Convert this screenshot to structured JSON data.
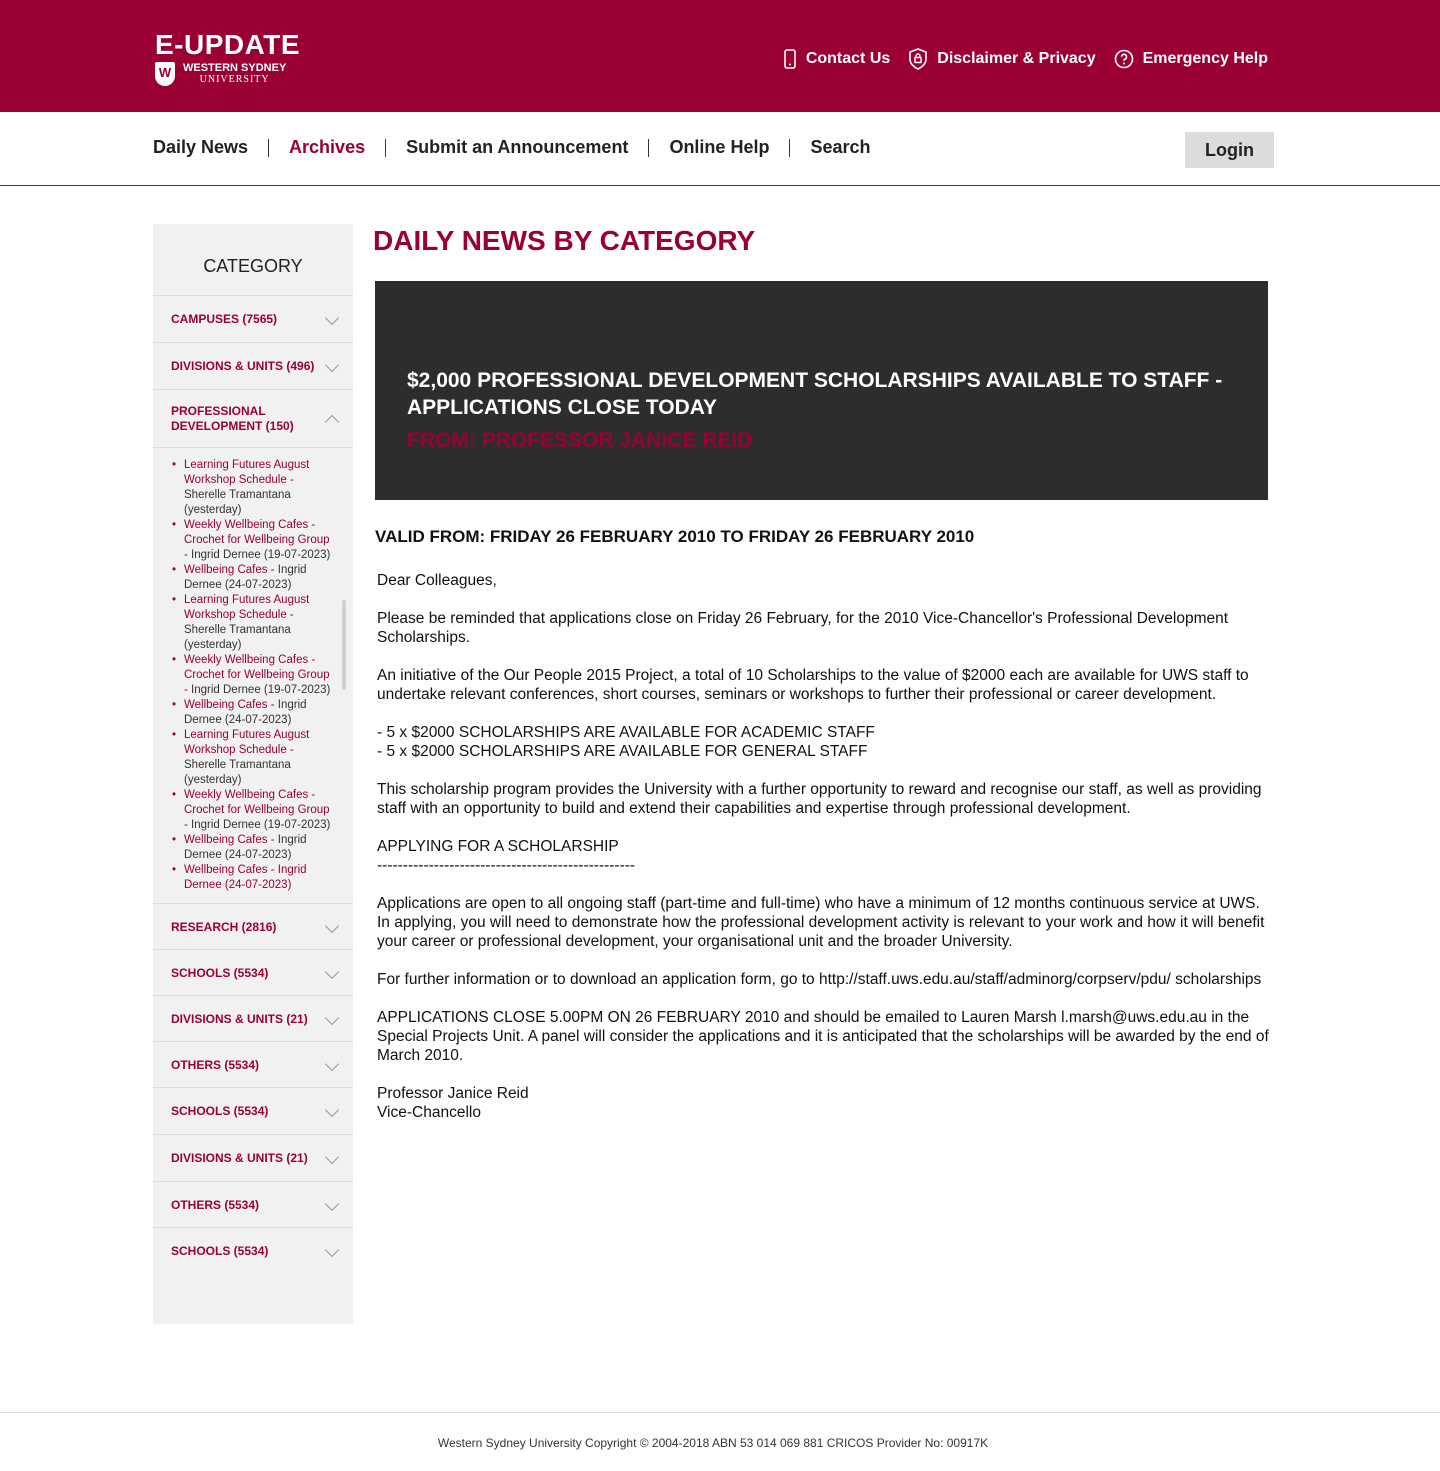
{
  "header": {
    "logo_title": "E-UPDATE",
    "logo_shield": "W",
    "logo_university_line1": "WESTERN SYDNEY",
    "logo_university_line2": "UNIVERSITY",
    "links": [
      {
        "label": "Contact Us",
        "icon": "phone-icon"
      },
      {
        "label": "Disclaimer & Privacy",
        "icon": "shield-lock-icon"
      },
      {
        "label": "Emergency Help",
        "icon": "help-circle-icon"
      }
    ]
  },
  "nav": {
    "items": [
      "Daily News",
      "Archives",
      "Submit an Announcement",
      "Online Help",
      "Search"
    ],
    "active": "Archives",
    "login_label": "Login"
  },
  "sidebar": {
    "heading": "CATEGORY",
    "top_items": [
      {
        "label": "CAMPUSES (7565)"
      },
      {
        "label": "DIVISIONS & UNITS (496)"
      },
      {
        "label": "PROFESSIONAL DEVELOPMENT (150)",
        "expanded": true
      }
    ],
    "sub_items": [
      {
        "link": "Learning Futures August Workshop Schedule - ",
        "meta": "Sherelle Tramantana (yesterday)"
      },
      {
        "link": "Weekly Wellbeing Cafes - Crochet for Wellbeing Group - ",
        "meta": "Ingrid Dernee (19-07-2023)"
      },
      {
        "link": "Wellbeing Cafes - ",
        "meta": "Ingrid Dernee (24-07-2023)"
      },
      {
        "link": "Learning Futures August Workshop Schedule - ",
        "meta": "Sherelle Tramantana (yesterday)"
      },
      {
        "link": "Weekly Wellbeing Cafes - Crochet for Wellbeing Group - ",
        "meta": "Ingrid Dernee (19-07-2023)"
      },
      {
        "link": "Wellbeing Cafes - ",
        "meta": "Ingrid Dernee (24-07-2023)"
      },
      {
        "link": "Learning Futures August Workshop Schedule - ",
        "meta": "Sherelle Tramantana (yesterday)"
      },
      {
        "link": "Weekly Wellbeing Cafes - Crochet for Wellbeing Group - ",
        "meta": "Ingrid Dernee (19-07-2023)"
      },
      {
        "link": "Wellbeing Cafes - ",
        "meta": "Ingrid Dernee (24-07-2023)"
      },
      {
        "link": "Wellbeing Cafes - Ingrid Dernee (24-07-2023)",
        "meta": ""
      }
    ],
    "bottom_items": [
      {
        "label": "RESEARCH (2816)"
      },
      {
        "label": "SCHOOLS (5534)"
      },
      {
        "label": "DIVISIONS & UNITS (21)"
      },
      {
        "label": "OTHERS (5534)"
      },
      {
        "label": "SCHOOLS (5534)"
      },
      {
        "label": "DIVISIONS & UNITS (21)"
      },
      {
        "label": "OTHERS (5534)"
      },
      {
        "label": "SCHOOLS (5534)"
      }
    ]
  },
  "main": {
    "title": "DAILY NEWS BY CATEGORY",
    "hero_title": "$2,000 PROFESSIONAL DEVELOPMENT SCHOLARSHIPS AVAILABLE TO STAFF - APPLICATIONS CLOSE TODAY",
    "hero_from": "FROM: PROFESSOR JANICE REID",
    "valid": "VALID FROM: FRIDAY 26 FEBRUARY 2010 TO FRIDAY 26 FEBRUARY 2010",
    "paragraphs": [
      "Dear Colleagues,",
      "Please be reminded that applications close on Friday 26 February, for the 2010 Vice-Chancellor's Professional Development Scholarships.",
      "An initiative of the Our People 2015 Project, a total of 10 Scholarships to the value of $2000 each are available for UWS staff to undertake relevant conferences, short courses, seminars or workshops to further their professional or career development.",
      "- 5 x $2000 SCHOLARSHIPS ARE AVAILABLE FOR ACADEMIC STAFF\n- 5 x $2000 SCHOLARSHIPS ARE AVAILABLE FOR GENERAL STAFF",
      "This scholarship program provides the University with a further opportunity to reward and recognise our staff, as well as providing staff with an opportunity to build and extend their capabilities and expertise through professional development.",
      "APPLYING FOR A SCHOLARSHIP\n--------------------------------------------------",
      "Applications are open to all ongoing staff (part-time and full-time) who have a minimum of 12 months continuous service at UWS. In applying, you will need to demonstrate how the professional development activity is relevant to your work and how it will benefit your career or professional development, your organisational unit and the broader University.",
      "For further information or to download an application form, go to http://staff.uws.edu.au/staff/adminorg/corpserv/pdu/ scholarships",
      "APPLICATIONS CLOSE 5.00PM ON 26 FEBRUARY 2010 and should be emailed to Lauren Marsh l.marsh@uws.edu.au in the Special Projects Unit. A panel will consider the applications and it is anticipated that the scholarships will be awarded by the end of March 2010.",
      "Professor Janice Reid\nVice-Chancello"
    ]
  },
  "footer": {
    "text": "Western Sydney University Copyright © 2004-2018 ABN 53 014 069 881 CRICOS Provider No: 00917K"
  },
  "colors": {
    "brand": "#9a0036",
    "hero_bg": "#2d2d2d",
    "sidebar_bg": "#f1f1f1"
  }
}
